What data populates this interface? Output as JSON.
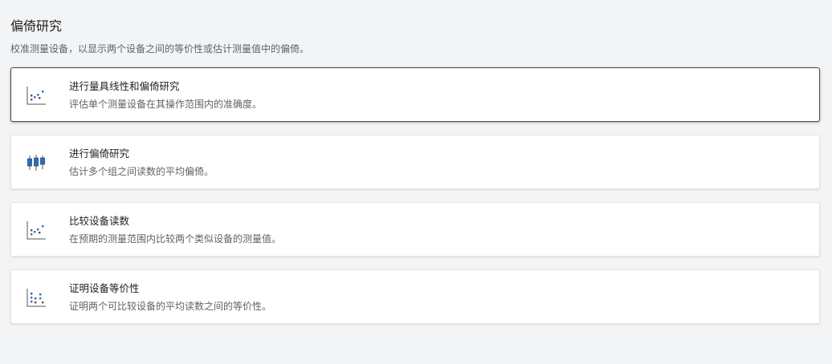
{
  "header": {
    "title": "偏倚研究",
    "subtitle": "校准测量设备，以显示两个设备之间的等价性或估计测量值中的偏倚。"
  },
  "options": [
    {
      "title": "进行量具线性和偏倚研究",
      "description": "评估单个测量设备在其操作范围内的准确度。",
      "icon": "scatter-plot-icon",
      "selected": true
    },
    {
      "title": "进行偏倚研究",
      "description": "估计多个组之间读数的平均偏倚。",
      "icon": "candlestick-chart-icon",
      "selected": false
    },
    {
      "title": "比较设备读数",
      "description": "在预期的测量范围内比较两个类似设备的测量值。",
      "icon": "scatter-plot-icon",
      "selected": false
    },
    {
      "title": "证明设备等价性",
      "description": "证明两个可比较设备的平均读数之间的等价性。",
      "icon": "dot-plot-icon",
      "selected": false
    }
  ],
  "colors": {
    "background": "#f3f4f6",
    "card": "#ffffff",
    "icon_blue": "#2f6db5",
    "selected_border": "#4a4a4a"
  }
}
